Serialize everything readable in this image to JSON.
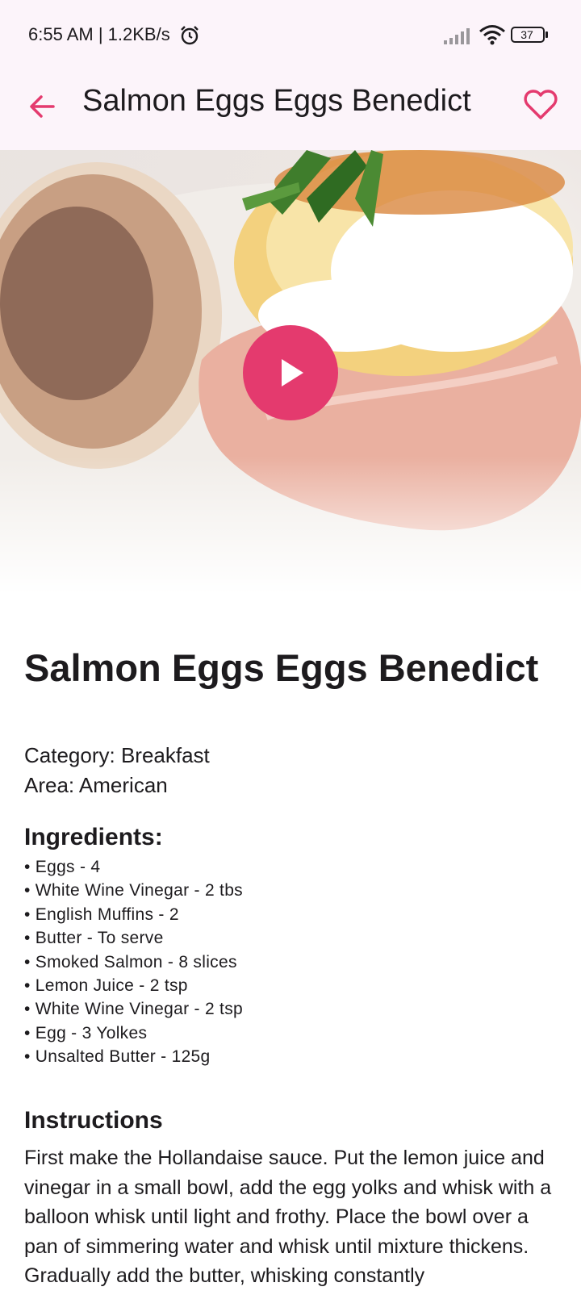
{
  "status_bar": {
    "time_speed": "6:55 AM | 1.2KB/s",
    "battery": "37",
    "icons": [
      "alarm-icon",
      "signal-icon",
      "wifi-icon",
      "battery-icon"
    ]
  },
  "app_bar": {
    "title": "Salmon Eggs Eggs Benedict",
    "back_icon": "arrow-back-icon",
    "favorite_icon": "heart-outline-icon",
    "accent_color": "#e43a6e"
  },
  "hero": {
    "play_icon": "play-icon"
  },
  "recipe": {
    "title": "Salmon Eggs Eggs Benedict",
    "category": "Category: Breakfast",
    "area": "Area: American",
    "ingredients_heading": "Ingredients:",
    "ingredients": [
      "• Eggs - 4",
      "• White Wine Vinegar - 2 tbs",
      "• English Muffins - 2",
      "• Butter - To serve",
      "• Smoked Salmon - 8 slices",
      "• Lemon Juice - 2 tsp",
      "• White Wine Vinegar - 2 tsp",
      "• Egg - 3 Yolkes",
      "• Unsalted Butter - 125g"
    ],
    "instructions_heading": "Instructions",
    "instructions": "First make the Hollandaise sauce. Put the lemon juice and vinegar in a small bowl, add the egg yolks and whisk with a balloon whisk until light and frothy. Place the bowl over a pan of simmering water and whisk until mixture thickens. Gradually add the butter, whisking constantly"
  }
}
